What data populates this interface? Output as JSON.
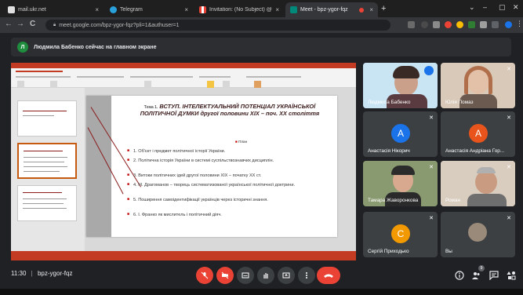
{
  "tabs": [
    {
      "label": "mail.ukr.net",
      "active": false
    },
    {
      "label": "Telegram",
      "active": false
    },
    {
      "label": "Invitation: (No Subject) @ Tue F",
      "active": false
    },
    {
      "label": "Meet - bpz-ygor-fqz",
      "active": true
    }
  ],
  "tab_close": "×",
  "new_tab": "+",
  "window_controls": [
    "⌄",
    "–",
    "▢",
    "✕"
  ],
  "address": {
    "url": "meet.google.com/bpz-ygor-fqz?pli=1&authuser=1",
    "back": "←",
    "forward": "→",
    "reload": "C"
  },
  "banner": {
    "avatar_letter": "Л",
    "text": "Людмила Бабенко сейчас на главном экране"
  },
  "slide": {
    "title_lead": "Тема 1.",
    "title": "ВСТУП. ІНТЕЛЕКТУАЛЬНИЙ ПОТЕНЦІАЛ УКРАЇНСЬКОЇ ПОЛІТИЧНОЇ ДУМКИ другої половини XIX – поч. XX століття",
    "plan": "План",
    "items": [
      "1. Об'єкт і предмет політичної історії України.",
      "2. Політична історія України в системі суспільствознавчих дисциплін.",
      "3. Витоки політичних ідей другої половини XIX – початку XX ст.",
      "4. М. Драгоманов – творець систематизованої української політичної доктрини.",
      "5. Поширення самоідентифікації українців через історичні знання.",
      "6. І. Франко як мислитель і політичний діяч."
    ]
  },
  "participants": [
    {
      "name": "Людмила Бабенко",
      "type": "video"
    },
    {
      "name": "Юлія Помаз",
      "type": "video"
    },
    {
      "name": "Анастасія Нікорич",
      "type": "avatar",
      "letter": "А",
      "color": "#1a73e8"
    },
    {
      "name": "Анастасія Андріана Гор...",
      "type": "avatar",
      "letter": "А",
      "color": "#e8541b"
    },
    {
      "name": "Тамара Жаворонкова",
      "type": "video"
    },
    {
      "name": "Роман",
      "type": "video"
    },
    {
      "name": "Сергій Приходько",
      "type": "avatar",
      "letter": "С",
      "color": "#f29900"
    },
    {
      "name": "Вы",
      "type": "video"
    }
  ],
  "meeting": {
    "time": "11:30",
    "separator": "|",
    "code": "bpz-ygor-fqz"
  },
  "people_count": "9",
  "colors": {
    "background": "#202124",
    "accent_red": "#ea4335",
    "banner_green": "#1e8e3e",
    "ppt_red": "#c23b22"
  }
}
